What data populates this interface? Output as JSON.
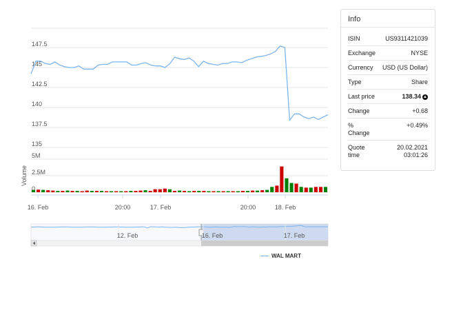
{
  "chart_data": {
    "type": "line",
    "y_ticks": [
      "147.5",
      "145",
      "142.5",
      "140",
      "137.5",
      "135"
    ],
    "ylim": [
      135,
      150
    ],
    "x_ticks": [
      "16. Feb",
      "20:00",
      "17. Feb",
      "20:00",
      "18. Feb"
    ],
    "series": [
      {
        "name": "WAL MART",
        "values": [
          144.2,
          145.8,
          145.8,
          145.5,
          145.4,
          145.7,
          145.3,
          145.1,
          145.0,
          145.0,
          145.2,
          144.8,
          144.8,
          144.8,
          145.3,
          145.4,
          145.4,
          145.7,
          145.7,
          145.7,
          145.7,
          145.3,
          145.3,
          145.5,
          145.6,
          145.3,
          145.2,
          145.2,
          145.0,
          145.5,
          146.3,
          146.1,
          146.0,
          146.2,
          145.8,
          145.1,
          145.8,
          145.5,
          145.4,
          145.3,
          145.5,
          145.5,
          145.7,
          145.7,
          145.6,
          145.9,
          146.1,
          146.3,
          146.4,
          146.5,
          146.7,
          147.0,
          147.7,
          147.5,
          138.4,
          139.2,
          139.2,
          138.8,
          138.6,
          138.8,
          138.5,
          138.8,
          139.1
        ]
      }
    ],
    "volume": {
      "label": "Volume",
      "y_ticks": [
        "5M",
        "2.5M",
        "0"
      ],
      "ylim": [
        0,
        5
      ],
      "values": [
        0.35,
        0.4,
        0.35,
        0.3,
        0.25,
        0.2,
        0.2,
        0.25,
        0.2,
        0.2,
        0.15,
        0.25,
        0.2,
        0.2,
        0.2,
        0.15,
        0.15,
        0.15,
        0.15,
        0.15,
        0.2,
        0.2,
        0.25,
        0.3,
        0.2,
        0.45,
        0.45,
        0.55,
        0.45,
        0.2,
        0.25,
        0.2,
        0.15,
        0.2,
        0.2,
        0.2,
        0.15,
        0.15,
        0.15,
        0.15,
        0.15,
        0.15,
        0.15,
        0.2,
        0.2,
        0.25,
        0.25,
        0.3,
        0.35,
        0.8,
        1.0,
        3.9,
        2.1,
        1.4,
        1.3,
        0.8,
        0.7,
        0.7,
        0.8,
        0.8,
        0.8
      ],
      "colors": [
        "#008000",
        "#cc0000",
        "#008000",
        "#cc0000",
        "#cc0000",
        "#008000",
        "#cc0000",
        "#008000",
        "#cc0000",
        "#008000",
        "#cc0000",
        "#cc0000",
        "#008000",
        "#cc0000",
        "#008000",
        "#cc0000",
        "#008000",
        "#cc0000",
        "#008000",
        "#cc0000",
        "#008000",
        "#cc0000",
        "#cc0000",
        "#008000",
        "#cc0000",
        "#cc0000",
        "#cc0000",
        "#cc0000",
        "#008000",
        "#cc0000",
        "#008000",
        "#cc0000",
        "#008000",
        "#cc0000",
        "#008000",
        "#cc0000",
        "#008000",
        "#cc0000",
        "#008000",
        "#cc0000",
        "#008000",
        "#cc0000",
        "#008000",
        "#cc0000",
        "#008000",
        "#cc0000",
        "#008000",
        "#cc0000",
        "#008000",
        "#008000",
        "#cc0000",
        "#cc0000",
        "#008000",
        "#008000",
        "#cc0000",
        "#008000",
        "#cc0000",
        "#008000",
        "#cc0000",
        "#cc0000",
        "#008000"
      ]
    },
    "navigator": {
      "x_ticks": [
        "12. Feb",
        "16. Feb",
        "17. Feb"
      ]
    },
    "legend_placement": "bottom"
  },
  "colors": {
    "line": "#7cb5ec",
    "up": "#008000",
    "down": "#cc0000",
    "grid": "#e6e6e6",
    "navigator_mask": "#c9d6ee"
  },
  "info": {
    "title": "Info",
    "rows": [
      {
        "key": "ISIN",
        "value": "US9311421039"
      },
      {
        "key": "Exchange",
        "value": "NYSE"
      },
      {
        "key": "Currency",
        "value": "USD (US Dollar)"
      },
      {
        "key": "Type",
        "value": "Share"
      },
      {
        "key": "Last price",
        "value": "138.34",
        "icon": "arrow-up-circle-icon"
      },
      {
        "key": "Change",
        "value": "+0.68"
      },
      {
        "key": "% Change",
        "value": "+0.49%"
      },
      {
        "key": "Quote time",
        "value": "20.02.2021 03:01:26"
      }
    ]
  }
}
